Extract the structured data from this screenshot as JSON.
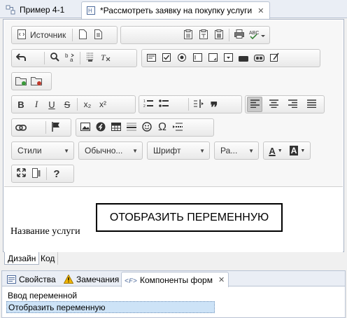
{
  "tabs": {
    "tab1_label": "Пример 4-1",
    "tab2_label": "*Рассмотреть заявку на покупку услуги",
    "close_glyph": "✕"
  },
  "toolbar": {
    "source_label": "Источник",
    "styles_label": "Стили",
    "format_label": "Обычно...",
    "font_label": "Шрифт",
    "size_label": "Ра...",
    "bold": "B",
    "italic": "I",
    "underline": "U",
    "strike": "S",
    "subscript": "x₂",
    "superscript": "x²",
    "help": "?",
    "omega": "Ω",
    "font_color": "A",
    "bg_color": "A"
  },
  "content": {
    "label": "Название услуги",
    "variable_box": "ОТОБРАЗИТЬ ПЕРЕМЕННУЮ"
  },
  "mode_tabs": {
    "design": "Дизайн",
    "code": "Код"
  },
  "panel": {
    "tabs": {
      "properties": "Свойства",
      "remarks": "Замечания",
      "components": "Компоненты форм"
    },
    "items": [
      "Ввод переменной",
      "Отобразить переменную"
    ]
  },
  "colors": {
    "tab_bar": "#eaeef5",
    "selection": "#cde3f7",
    "warning": "#f2b600"
  }
}
